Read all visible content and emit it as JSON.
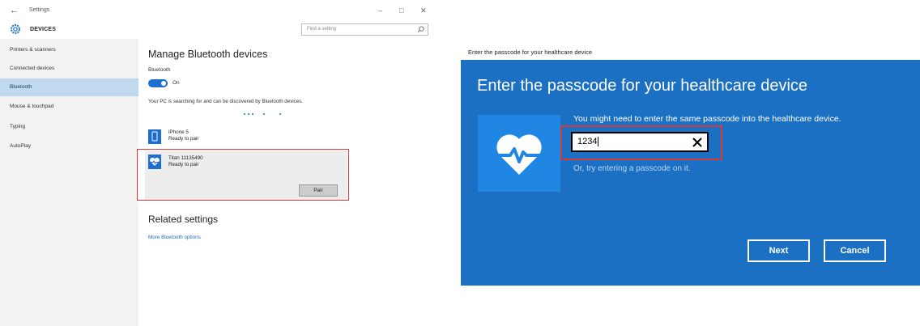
{
  "settings": {
    "window_title": "Settings",
    "section": "DEVICES",
    "search_placeholder": "Find a setting",
    "nav": [
      {
        "label": "Printers & scanners",
        "active": false
      },
      {
        "label": "Connected devices",
        "active": false
      },
      {
        "label": "Bluetooth",
        "active": true
      },
      {
        "label": "Mouse & touchpad",
        "active": false
      },
      {
        "label": "Typing",
        "active": false
      },
      {
        "label": "AutoPlay",
        "active": false
      }
    ],
    "heading": "Manage Bluetooth devices",
    "bluetooth_label": "Bluetooth",
    "toggle_state": "On",
    "searching_text": "Your PC is searching for and can be discovered by Bluetooth devices.",
    "devices": [
      {
        "name": "iPhone 5",
        "status": "Ready to pair",
        "icon": "phone-icon"
      },
      {
        "name": "Titan 11135490",
        "status": "Ready to pair",
        "icon": "heart-icon"
      }
    ],
    "pair_label": "Pair",
    "related_heading": "Related settings",
    "more_options_link": "More Bluetooth options"
  },
  "dialog": {
    "caption": "Enter the passcode for your healthcare device",
    "title": "Enter the passcode for your healthcare device",
    "message": "You might need to enter the same passcode into the healthcare device.",
    "passcode_value": "1234",
    "hint": "Or, try entering a passcode on it.",
    "next_label": "Next",
    "cancel_label": "Cancel"
  },
  "colors": {
    "accent": "#1c6fd1",
    "dialog_bg": "#1b70c4",
    "highlight": "#d33b3b",
    "selected_nav": "#c1d9ee"
  }
}
